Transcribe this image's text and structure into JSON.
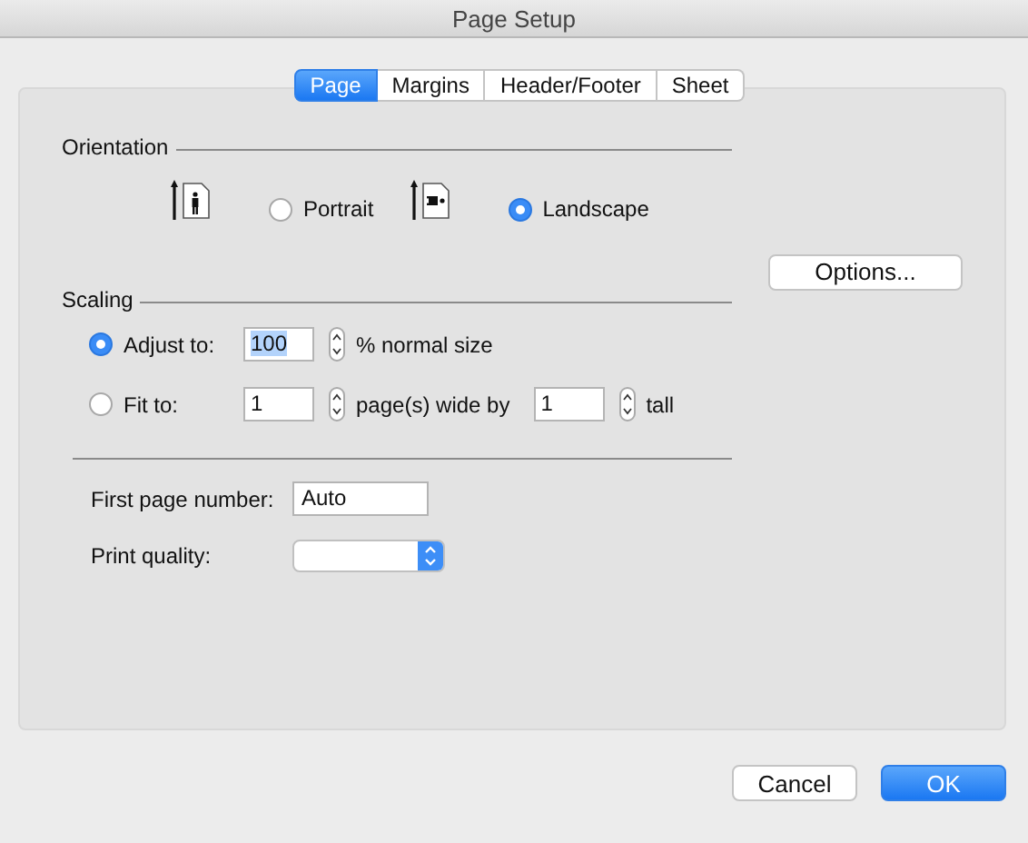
{
  "window": {
    "title": "Page Setup"
  },
  "tabs": [
    {
      "label": "Page",
      "selected": true
    },
    {
      "label": "Margins",
      "selected": false
    },
    {
      "label": "Header/Footer",
      "selected": false
    },
    {
      "label": "Sheet",
      "selected": false
    }
  ],
  "orientation": {
    "title": "Orientation",
    "options": [
      {
        "label": "Portrait",
        "kind": "portrait",
        "selected": false
      },
      {
        "label": "Landscape",
        "kind": "landscape",
        "selected": true
      }
    ]
  },
  "options_button": "Options...",
  "scaling": {
    "title": "Scaling",
    "options": [
      {
        "label": "Adjust to:",
        "selected": true,
        "parts": [
          {
            "kind": "spin",
            "value": "100",
            "highlighted": true
          },
          {
            "kind": "text",
            "text": "% normal size"
          }
        ]
      },
      {
        "label": "Fit to:",
        "selected": false,
        "parts": [
          {
            "kind": "spin",
            "value": "1",
            "highlighted": false
          },
          {
            "kind": "text",
            "text": "page(s) wide by"
          },
          {
            "kind": "spin",
            "value": "1",
            "highlighted": false
          },
          {
            "kind": "text",
            "text": "tall"
          }
        ]
      }
    ]
  },
  "first_page_number": {
    "label": "First page number:",
    "value": "Auto"
  },
  "print_quality": {
    "label": "Print quality:"
  },
  "buttons": [
    {
      "label": "Cancel",
      "default": false
    },
    {
      "label": "OK",
      "default": true
    }
  ]
}
